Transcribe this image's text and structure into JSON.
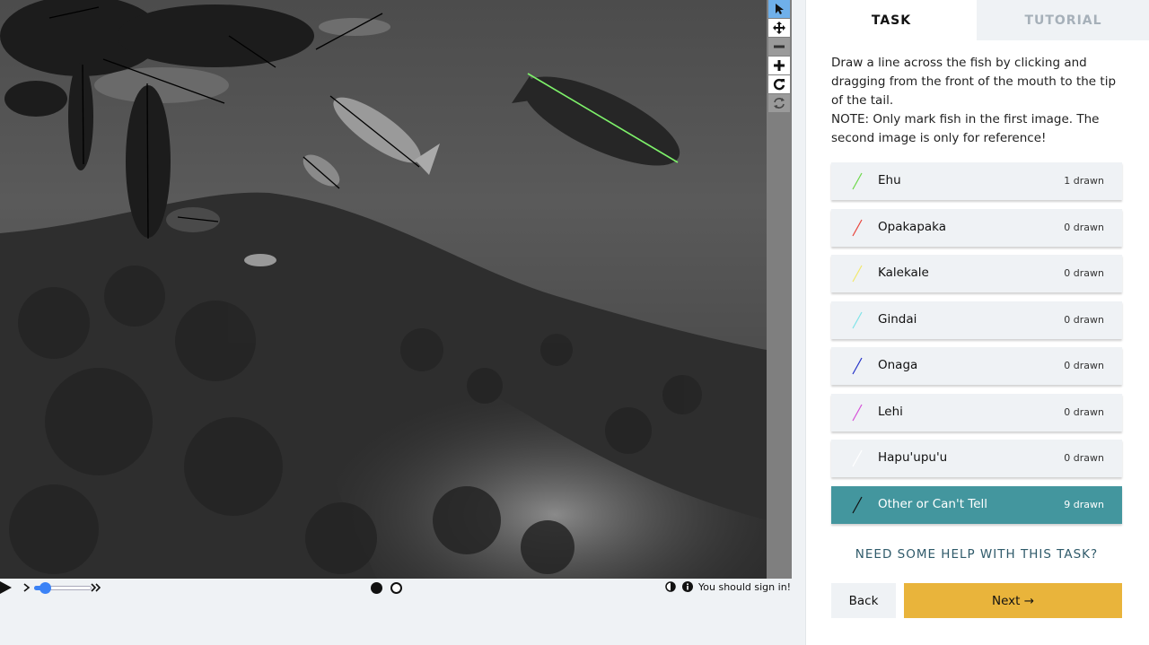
{
  "tabs": {
    "task": "TASK",
    "tutorial": "TUTORIAL"
  },
  "instructions": {
    "line1": "Draw a line across the fish by clicking and dragging from the front of the mouth to the tip of the tail.",
    "line2": "NOTE: Only mark fish in the first image. The second image is only for reference!"
  },
  "choices": [
    {
      "label": "Ehu",
      "count": "1 drawn",
      "color": "#6bd848"
    },
    {
      "label": "Opakapaka",
      "count": "0 drawn",
      "color": "#e8453c"
    },
    {
      "label": "Kalekale",
      "count": "0 drawn",
      "color": "#f2e86a"
    },
    {
      "label": "Gindai",
      "count": "0 drawn",
      "color": "#7fe3e8"
    },
    {
      "label": "Onaga",
      "count": "0 drawn",
      "color": "#2432c8"
    },
    {
      "label": "Lehi",
      "count": "0 drawn",
      "color": "#d64fd8"
    },
    {
      "label": "Hapu'upu'u",
      "count": "0 drawn",
      "color": "#ffffff"
    },
    {
      "label": "Other or Can't Tell",
      "count": "9 drawn",
      "color": "#111111",
      "selected": true
    }
  ],
  "help_link": "NEED SOME HELP WITH THIS TASK?",
  "buttons": {
    "back": "Back",
    "next": "Next →"
  },
  "controls": {
    "signin": "You should sign in!"
  },
  "icons": {
    "toolbar": [
      "pointer-icon",
      "move-icon",
      "zoom-out-icon",
      "zoom-in-icon",
      "rotate-icon",
      "reset-icon"
    ],
    "playback": [
      "play-icon",
      "step-forward-icon",
      "fast-forward-icon"
    ],
    "status": [
      "contrast-icon",
      "info-icon"
    ]
  }
}
